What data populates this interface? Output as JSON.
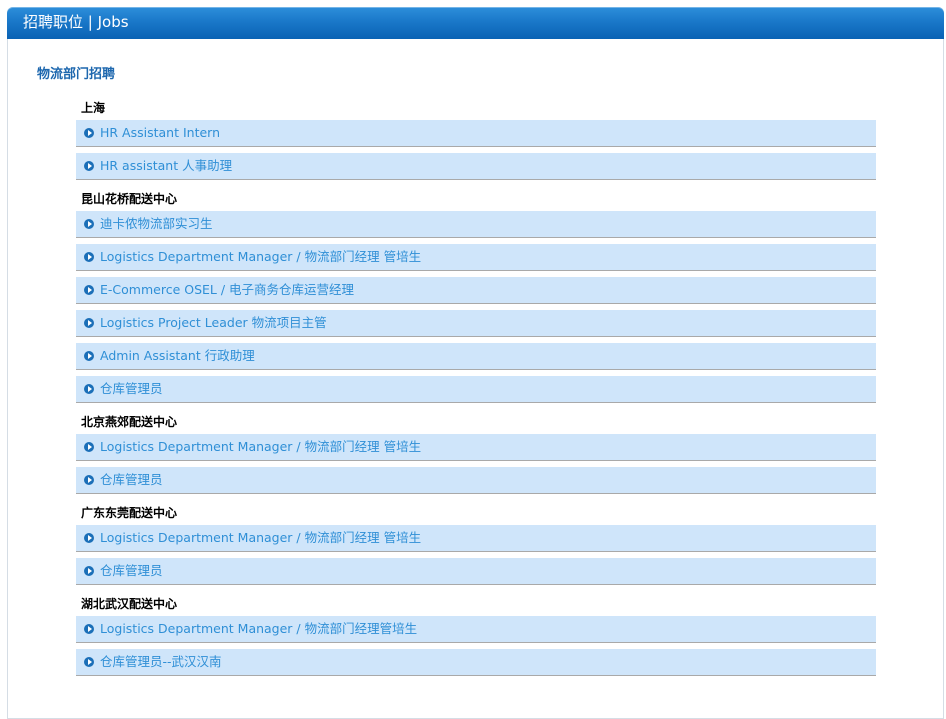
{
  "header": {
    "title": "招聘职位 | Jobs"
  },
  "section": {
    "title": "物流部门招聘"
  },
  "groups": [
    {
      "label": "上海",
      "jobs": [
        "HR Assistant Intern",
        "HR assistant 人事助理"
      ]
    },
    {
      "label": "昆山花桥配送中心",
      "jobs": [
        "迪卡侬物流部实习生",
        "Logistics Department Manager / 物流部门经理 管培生",
        "E-Commerce OSEL / 电子商务仓库运营经理",
        "Logistics Project Leader 物流项目主管",
        "Admin Assistant 行政助理",
        "仓库管理员"
      ]
    },
    {
      "label": "北京燕郊配送中心",
      "jobs": [
        "Logistics Department Manager / 物流部门经理 管培生",
        "仓库管理员"
      ]
    },
    {
      "label": "广东东莞配送中心",
      "jobs": [
        "Logistics Department Manager / 物流部门经理 管培生",
        "仓库管理员"
      ]
    },
    {
      "label": "湖北武汉配送中心",
      "jobs": [
        "Logistics Department Manager / 物流部门经理管培生",
        "仓库管理员--武汉汉南"
      ]
    }
  ],
  "colors": {
    "header_blue": "#0a62b4",
    "row_background": "#cfe5fa",
    "link_color": "#2f8fd6",
    "section_title_color": "#1d67ae"
  },
  "icons": {
    "bullet": "circle-arrow-right-icon"
  }
}
